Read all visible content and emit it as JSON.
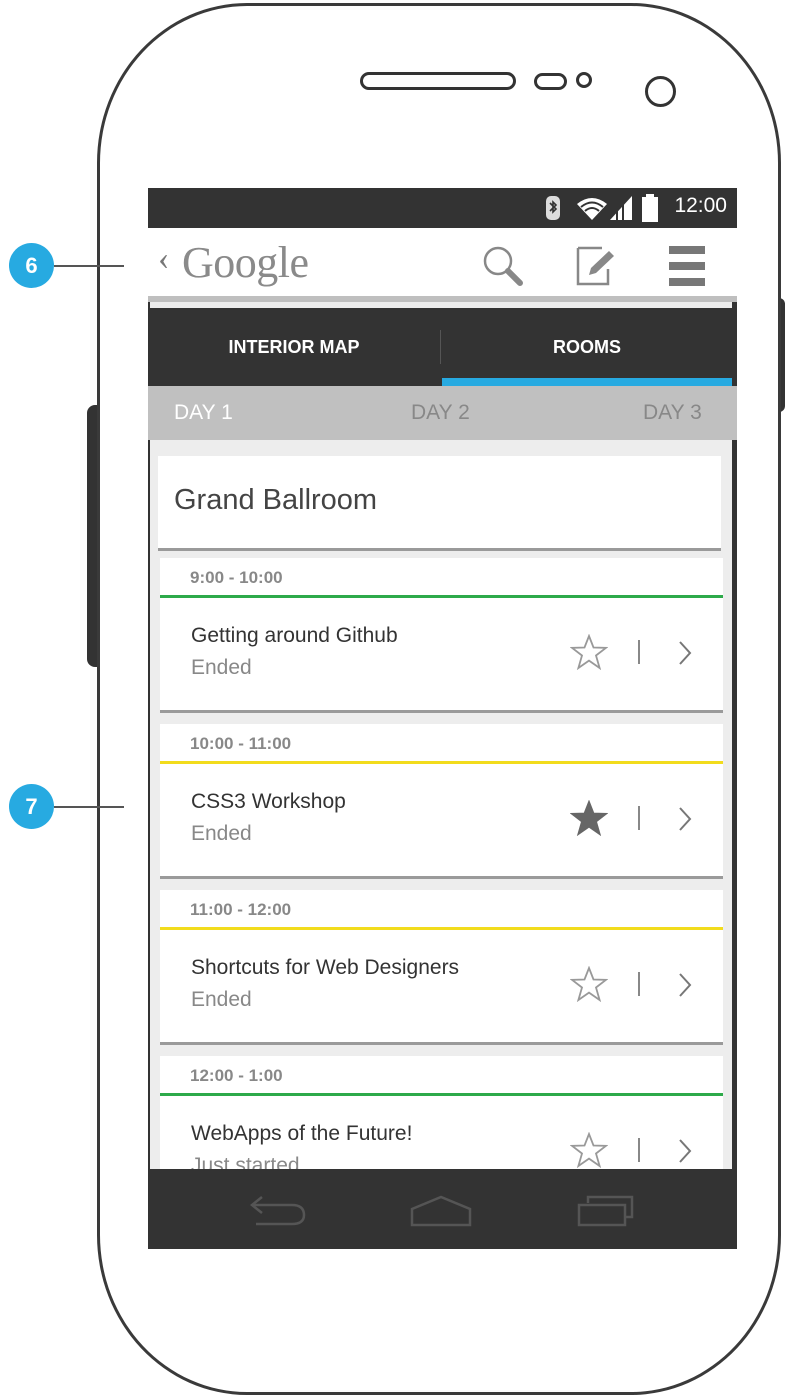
{
  "callouts": [
    "6",
    "7"
  ],
  "status_bar": {
    "time": "12:00"
  },
  "action_bar": {
    "back_glyph": "‹",
    "logo": "Google",
    "icons": [
      "search-icon",
      "compose-icon",
      "menu-icon"
    ]
  },
  "tabs": [
    {
      "label": "INTERIOR MAP",
      "active": false
    },
    {
      "label": "ROOMS",
      "active": true
    }
  ],
  "days": [
    {
      "label": "DAY 1",
      "active": true
    },
    {
      "label": "DAY 2",
      "active": false
    },
    {
      "label": "DAY 3",
      "active": false
    }
  ],
  "room": {
    "name": "Grand Ballroom"
  },
  "sessions": [
    {
      "time": "9:00 - 10:00",
      "title": "Getting around Github",
      "status": "Ended",
      "starred": false,
      "color": "#2daa4a"
    },
    {
      "time": "10:00 - 11:00",
      "title": "CSS3 Workshop",
      "status": "Ended",
      "starred": true,
      "color": "#f2dc1c"
    },
    {
      "time": "11:00 - 12:00",
      "title": "Shortcuts for Web Designers",
      "status": "Ended",
      "starred": false,
      "color": "#f2dc1c"
    },
    {
      "time": "12:00 - 1:00",
      "title": "WebApps of the Future!",
      "status": "Just started",
      "starred": false,
      "color": "#2daa4a"
    }
  ],
  "colors": {
    "accent": "#27aae1",
    "dark": "#333333",
    "callout": "#27aae1"
  }
}
